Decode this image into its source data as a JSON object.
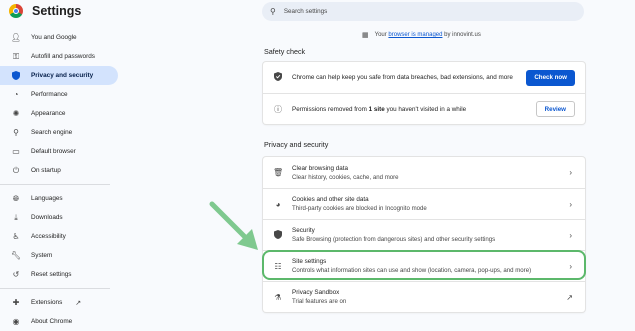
{
  "app": {
    "title": "Settings"
  },
  "sidebar": {
    "items": [
      {
        "label": "You and Google",
        "icon": "person-icon"
      },
      {
        "label": "Autofill and passwords",
        "icon": "key-icon"
      },
      {
        "label": "Privacy and security",
        "icon": "shield-icon",
        "active": true
      },
      {
        "label": "Performance",
        "icon": "speedometer-icon"
      },
      {
        "label": "Appearance",
        "icon": "palette-icon"
      },
      {
        "label": "Search engine",
        "icon": "search-icon"
      },
      {
        "label": "Default browser",
        "icon": "browser-icon"
      },
      {
        "label": "On startup",
        "icon": "power-icon"
      }
    ],
    "items2": [
      {
        "label": "Languages",
        "icon": "globe-icon"
      },
      {
        "label": "Downloads",
        "icon": "download-icon"
      },
      {
        "label": "Accessibility",
        "icon": "accessibility-icon"
      },
      {
        "label": "System",
        "icon": "wrench-icon"
      },
      {
        "label": "Reset settings",
        "icon": "history-icon"
      }
    ],
    "items3": [
      {
        "label": "Extensions",
        "icon": "puzzle-icon"
      },
      {
        "label": "About Chrome",
        "icon": "chrome-icon"
      }
    ]
  },
  "search": {
    "placeholder": "Search settings"
  },
  "managed": {
    "prefix": "Your",
    "link": "browser is managed",
    "suffix": "by innovint.us"
  },
  "safety_check": {
    "heading": "Safety check",
    "rows": [
      {
        "text": "Chrome can help keep you safe from data breaches, bad extensions, and more",
        "button": "Check now"
      },
      {
        "text_before": "Permissions removed from ",
        "text_bold": "1 site",
        "text_after": " you haven't visited in a while",
        "button": "Review"
      }
    ]
  },
  "privacy": {
    "heading": "Privacy and security",
    "rows": [
      {
        "title": "Clear browsing data",
        "sub": "Clear history, cookies, cache, and more"
      },
      {
        "title": "Cookies and other site data",
        "sub": "Third-party cookies are blocked in Incognito mode"
      },
      {
        "title": "Security",
        "sub": "Safe Browsing (protection from dangerous sites) and other security settings"
      },
      {
        "title": "Site settings",
        "sub": "Controls what information sites can use and show (location, camera, pop-ups, and more)"
      },
      {
        "title": "Privacy Sandbox",
        "sub": "Trial features are on"
      }
    ]
  },
  "colors": {
    "accent": "#0b57d0",
    "active_bg": "#d3e3fd",
    "highlight": "#5cb86b"
  }
}
